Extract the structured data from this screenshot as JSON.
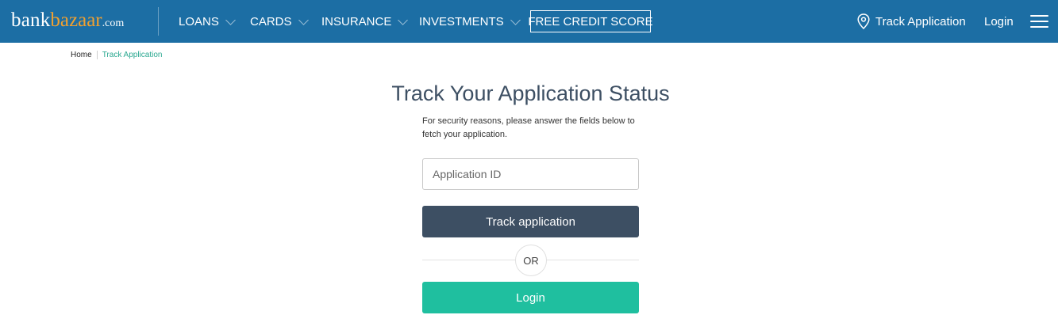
{
  "brand": {
    "logo_bank": "bank",
    "logo_bazaar": "bazaar",
    "logo_com": ".com",
    "primary_color": "#1c6ea4",
    "accent_color": "#f0a030"
  },
  "nav": {
    "items": [
      {
        "label": "LOANS",
        "icon": "chevron-down-icon"
      },
      {
        "label": "CARDS",
        "icon": "chevron-down-icon"
      },
      {
        "label": "INSURANCE",
        "icon": "chevron-down-icon"
      },
      {
        "label": "INVESTMENTS",
        "icon": "chevron-down-icon"
      }
    ],
    "free_credit_score": "FREE CREDIT SCORE",
    "track_application": "Track Application",
    "track_icon": "location-pin-icon",
    "login": "Login",
    "menu_icon": "hamburger-menu-icon"
  },
  "breadcrumb": {
    "home": "Home",
    "current": "Track Application"
  },
  "main": {
    "title": "Track Your Application Status",
    "subtitle": "For security reasons, please answer the fields below to fetch your application.",
    "application_id_placeholder": "Application ID",
    "track_button": "Track application",
    "or_text": "OR",
    "login_button": "Login",
    "track_button_color": "#3d4f63",
    "login_button_color": "#1fbf9f"
  }
}
